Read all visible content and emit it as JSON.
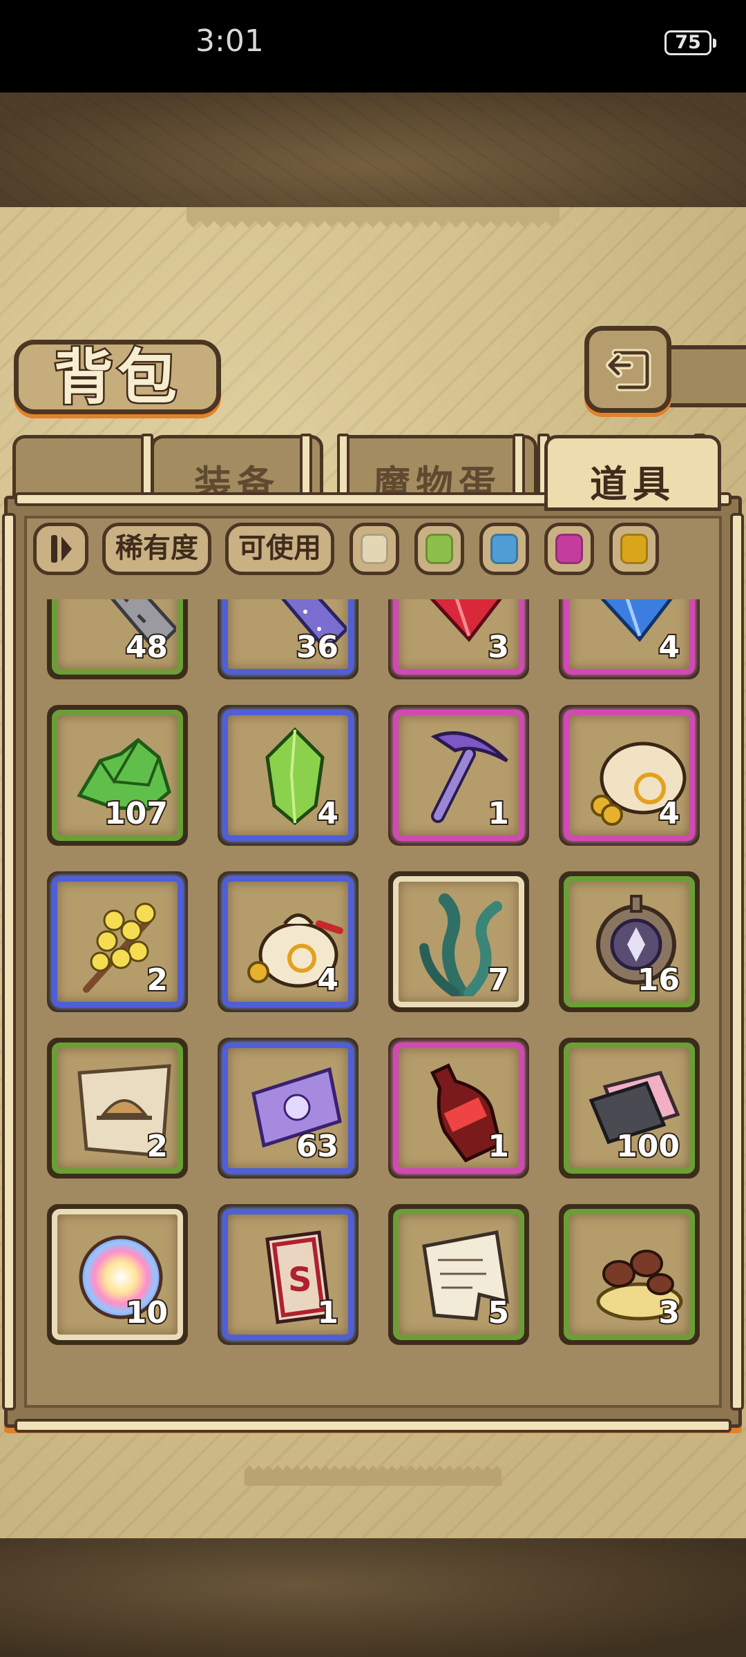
{
  "status_bar": {
    "time": "3:01",
    "battery": "75"
  },
  "header": {
    "title": "背包"
  },
  "tabs": [
    {
      "label": "装备",
      "active": false
    },
    {
      "label": "魔物蛋",
      "active": false
    },
    {
      "label": "道具",
      "active": true
    }
  ],
  "filters": {
    "sort_icon": "sort-toggle-icon",
    "rarity_label": "稀有度",
    "usable_label": "可使用",
    "rarity_colors": [
      "#e3d6b3",
      "#8dbf4b",
      "#4f9ed6",
      "#c43d9c",
      "#d9a51b"
    ]
  },
  "rarity_colors": {
    "green": "#6c9e37",
    "blue": "#4f5fd6",
    "pink": "#d04ab3",
    "white": "#e9dcb8"
  },
  "items": [
    {
      "icon": "stone-bar-icon",
      "count": "48",
      "rarity": "green"
    },
    {
      "icon": "starry-bar-icon",
      "count": "36",
      "rarity": "blue"
    },
    {
      "icon": "red-crystal-icon",
      "count": "3",
      "rarity": "pink"
    },
    {
      "icon": "blue-crystal-icon",
      "count": "4",
      "rarity": "pink"
    },
    {
      "icon": "green-ore-pile-icon",
      "count": "107",
      "rarity": "green"
    },
    {
      "icon": "green-crystal-icon",
      "count": "4",
      "rarity": "blue"
    },
    {
      "icon": "pickaxe-icon",
      "count": "1",
      "rarity": "pink"
    },
    {
      "icon": "large-coin-bag-icon",
      "count": "4",
      "rarity": "pink"
    },
    {
      "icon": "yellow-flower-branch-icon",
      "count": "2",
      "rarity": "blue"
    },
    {
      "icon": "coin-bag-icon",
      "count": "4",
      "rarity": "blue"
    },
    {
      "icon": "seaweed-icon",
      "count": "7",
      "rarity": "white"
    },
    {
      "icon": "shield-emblem-icon",
      "count": "16",
      "rarity": "green"
    },
    {
      "icon": "treasure-map-icon",
      "count": "2",
      "rarity": "green"
    },
    {
      "icon": "purple-ticket-icon",
      "count": "63",
      "rarity": "blue"
    },
    {
      "icon": "cola-bottle-icon",
      "count": "1",
      "rarity": "pink"
    },
    {
      "icon": "data-chip-icon",
      "count": "100",
      "rarity": "green"
    },
    {
      "icon": "rainbow-orb-icon",
      "count": "10",
      "rarity": "white"
    },
    {
      "icon": "s-card-icon",
      "count": "1",
      "rarity": "blue"
    },
    {
      "icon": "torn-letter-icon",
      "count": "5",
      "rarity": "green"
    },
    {
      "icon": "mushroom-cluster-icon",
      "count": "3",
      "rarity": "green"
    }
  ]
}
